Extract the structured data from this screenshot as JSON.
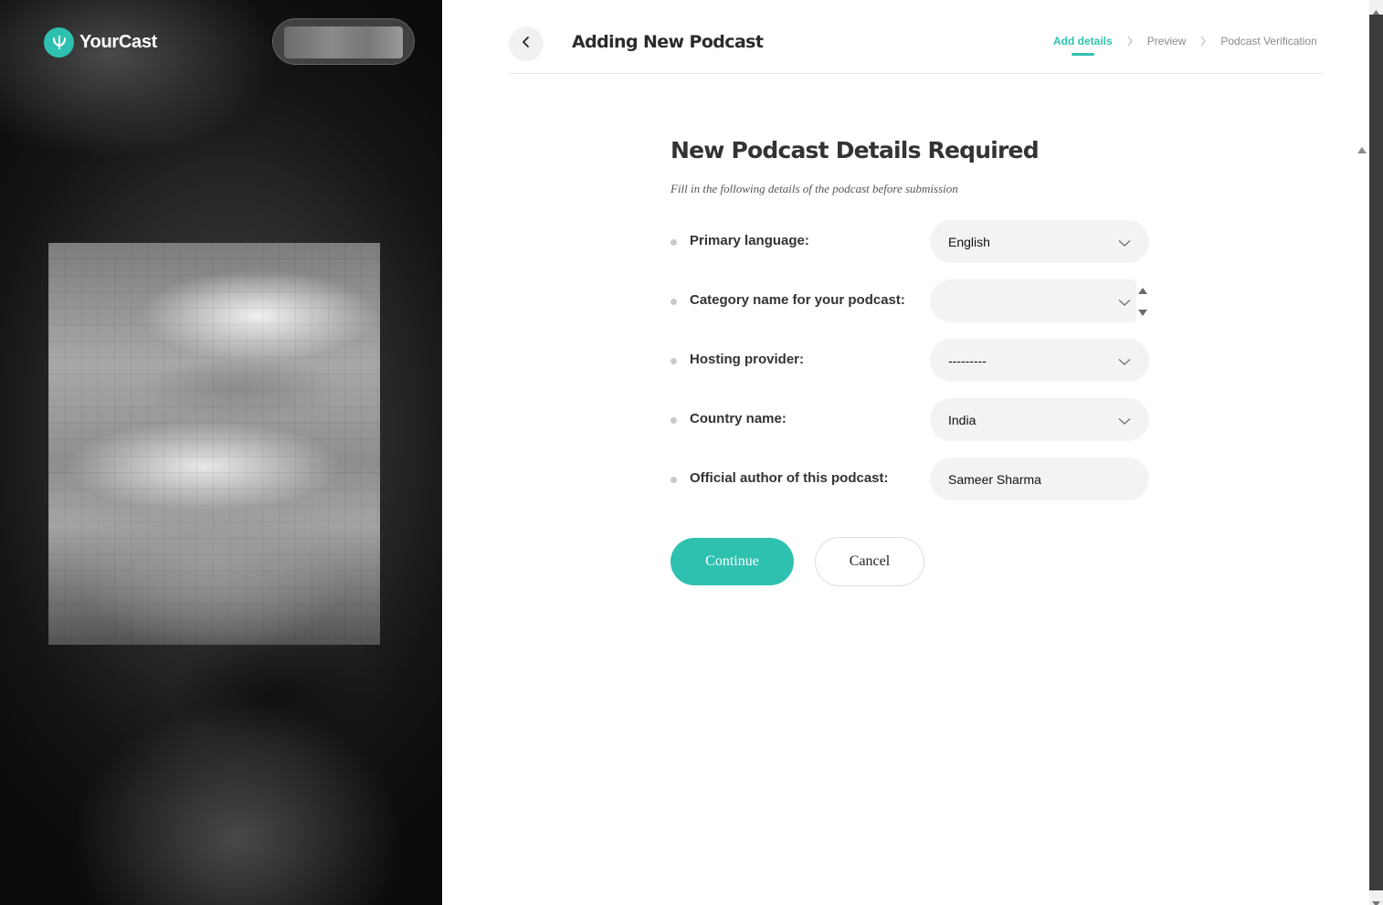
{
  "brand": {
    "name": "YourCast",
    "logo_icon": "leaf-icon",
    "accent": "#2fc1b0"
  },
  "header": {
    "back_icon": "chevron-left-icon",
    "title": "Adding New Podcast",
    "steps": [
      {
        "label": "Add details",
        "active": true
      },
      {
        "label": "Preview",
        "active": false
      },
      {
        "label": "Podcast Verification",
        "active": false
      }
    ]
  },
  "form": {
    "heading": "New Podcast Details Required",
    "subheading": "Fill in the following details of the podcast before submission",
    "fields": [
      {
        "label": "Primary language:",
        "type": "select",
        "value": "English"
      },
      {
        "label": "Category name for your podcast:",
        "type": "select",
        "value": ""
      },
      {
        "label": "Hosting provider:",
        "type": "select",
        "value": "---------"
      },
      {
        "label": "Country name:",
        "type": "select",
        "value": "India"
      },
      {
        "label": "Official author of this podcast:",
        "type": "text",
        "value": "Sameer Sharma"
      }
    ],
    "continue_label": "Continue",
    "cancel_label": "Cancel"
  },
  "colors": {
    "accent": "#2fc1b0",
    "field_bg": "#f3f3f3",
    "text": "#333333"
  }
}
